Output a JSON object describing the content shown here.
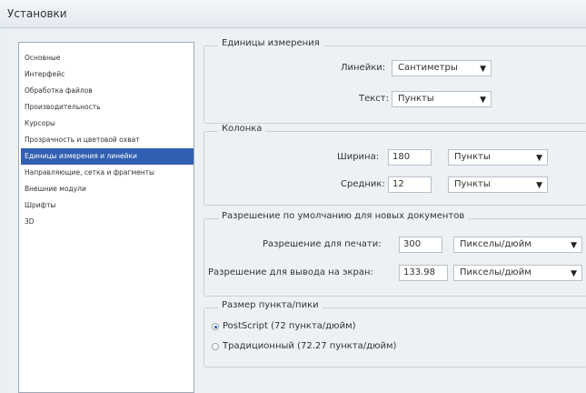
{
  "window": {
    "title": "Установки"
  },
  "sidebar": {
    "items": [
      {
        "label": "Основные"
      },
      {
        "label": "Интерфейс"
      },
      {
        "label": "Обработка файлов"
      },
      {
        "label": "Производительность"
      },
      {
        "label": "Курсоры"
      },
      {
        "label": "Прозрачность и цветовой охват"
      },
      {
        "label": "Единицы измерения и линейки"
      },
      {
        "label": "Направляющие, сетка и фрагменты"
      },
      {
        "label": "Внешние модули"
      },
      {
        "label": "Шрифты"
      },
      {
        "label": "3D"
      }
    ],
    "selected_index": 6
  },
  "units_group": {
    "legend": "Единицы измерения",
    "rulers_label": "Линейки:",
    "rulers_value": "Сантиметры",
    "text_label": "Текст:",
    "text_value": "Пункты"
  },
  "column_group": {
    "legend": "Колонка",
    "width_label": "Ширина:",
    "width_value": "180",
    "width_unit": "Пункты",
    "gutter_label": "Средник:",
    "gutter_value": "12",
    "gutter_unit": "Пункты"
  },
  "resolution_group": {
    "legend": "Разрешение по умолчанию для новых документов",
    "print_label": "Разрешение для печати:",
    "print_value": "300",
    "print_unit": "Пикселы/дюйм",
    "screen_label": "Разрешение для вывода на экран:",
    "screen_value": "133.98",
    "screen_unit": "Пикселы/дюйм"
  },
  "point_group": {
    "legend": "Размер пункта/пики",
    "options": [
      {
        "label": "PostScript (72 пункта/дюйм)",
        "checked": true
      },
      {
        "label": "Традиционный (72.27 пункта/дюйм)",
        "checked": false
      }
    ]
  }
}
